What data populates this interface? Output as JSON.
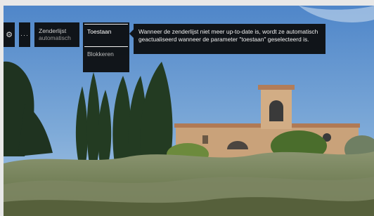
{
  "toolbar": {
    "gear_icon": "gear-icon",
    "more_label": "···",
    "channel_list_label": "Zenderlijst",
    "channel_list_value": "automatisch"
  },
  "dropdown": {
    "options": [
      "Toestaan",
      "Blokkeren"
    ],
    "selected": "Toestaan"
  },
  "tooltip": {
    "text": "Wanneer de zenderlijst niet meer up-to-date is, wordt ze automatisch geactualiseerd wanneer de parameter \"toestaan\" geselecteerd is."
  },
  "colors": {
    "osd_background": "#0a0a0a",
    "sky": "#5d8ec9",
    "building": "#c9a27a"
  }
}
